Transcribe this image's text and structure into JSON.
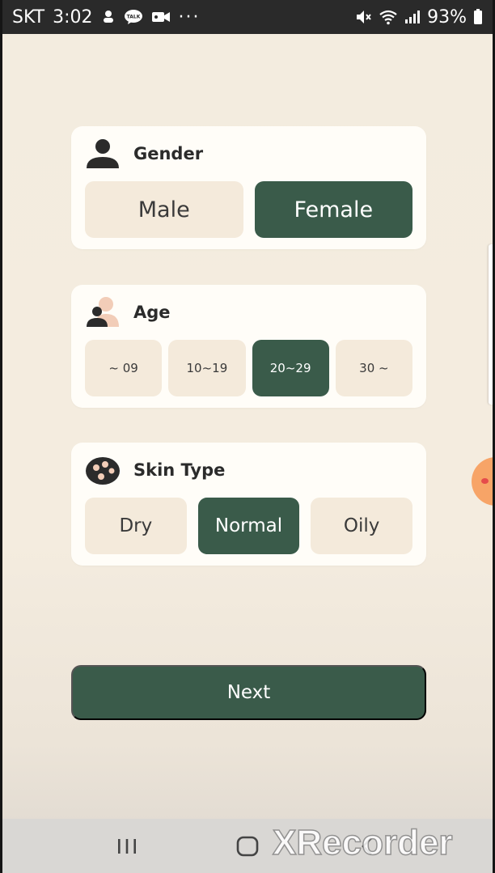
{
  "status_bar": {
    "carrier": "SKT",
    "time": "3:02",
    "battery": "93%",
    "icons": [
      "notification-icon",
      "kakaotalk-icon",
      "video-icon",
      "more-dots-icon",
      "mute-icon",
      "wifi-icon",
      "signal-icon",
      "battery-icon"
    ],
    "more": "···"
  },
  "gender": {
    "title": "Gender",
    "icon": "person-icon",
    "options": [
      {
        "label": "Male",
        "selected": false
      },
      {
        "label": "Female",
        "selected": true
      }
    ]
  },
  "age": {
    "title": "Age",
    "icon": "people-icon",
    "options": [
      {
        "label": "~ 09",
        "selected": false
      },
      {
        "label": "10~19",
        "selected": false
      },
      {
        "label": "20~29",
        "selected": true
      },
      {
        "label": "30 ~",
        "selected": false
      }
    ]
  },
  "skin": {
    "title": "Skin Type",
    "icon": "palette-icon",
    "options": [
      {
        "label": "Dry",
        "selected": false
      },
      {
        "label": "Normal",
        "selected": true
      },
      {
        "label": "Oily",
        "selected": false
      }
    ]
  },
  "next_label": "Next",
  "watermark": "XRecorder",
  "colors": {
    "accent": "#3a5b4a",
    "background": "#f3ecdf",
    "option_bg": "#f4eadb",
    "card_bg": "#fffdf8"
  }
}
